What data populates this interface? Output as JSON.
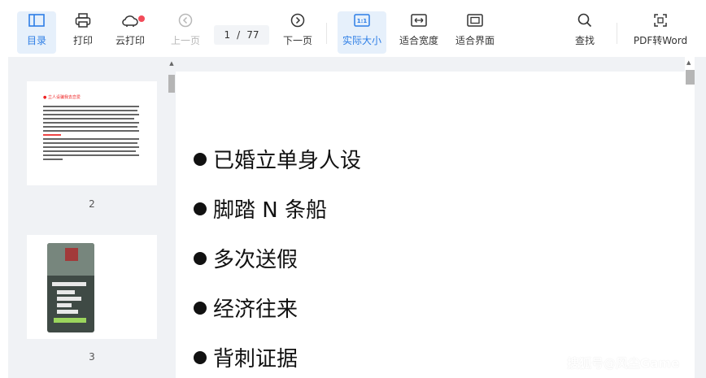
{
  "toolbar": {
    "toc": "目录",
    "print": "打印",
    "cloud_print": "云打印",
    "prev_page": "上一页",
    "current_page": "1",
    "page_sep": "/",
    "total_pages": "77",
    "next_page": "下一页",
    "actual_size": "实际大小",
    "fit_width": "适合宽度",
    "fit_screen": "适合界面",
    "find": "查找",
    "pdf_to_word": "PDF转Word"
  },
  "icons": {
    "toc": "sidebar-icon",
    "print": "printer-icon",
    "cloud_print": "cloud-icon",
    "prev": "circle-left-icon",
    "next": "circle-right-icon",
    "actual_size": "one-to-one-icon",
    "fit_width": "fit-width-icon",
    "fit_screen": "fit-screen-icon",
    "find": "search-icon",
    "pdf_to_word": "convert-icon"
  },
  "colors": {
    "accent": "#2d7ee6",
    "active_bg": "#e6f0fb",
    "badge": "#f24b59"
  },
  "sidebar": {
    "thumbnails": [
      {
        "page_number": "2",
        "mini_title": "● 立人设骗我去恋爱"
      },
      {
        "page_number": "3"
      }
    ]
  },
  "document": {
    "bullets": [
      "已婚立单身人设",
      "脚踏 N 条船",
      "多次送假",
      "经济往来",
      "背刺证据"
    ]
  },
  "watermark": "搜狐号@风尘Game"
}
